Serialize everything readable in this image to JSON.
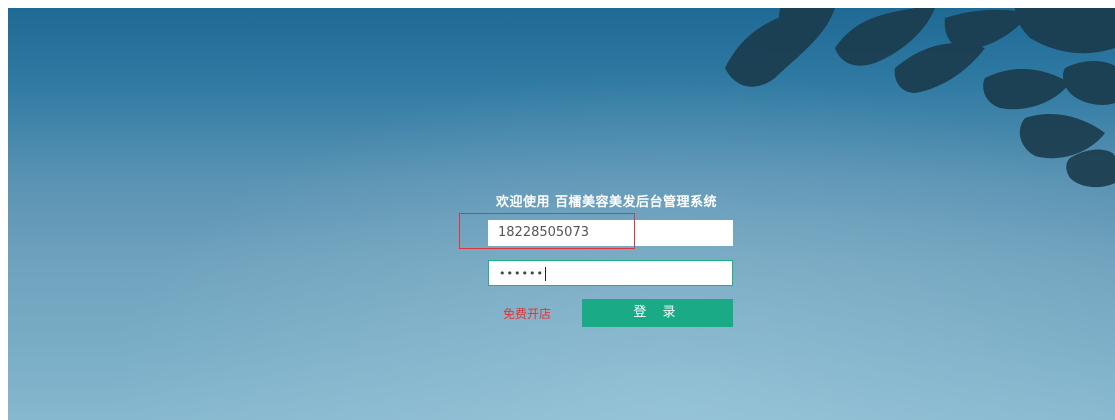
{
  "login": {
    "title": "欢迎使用 百檑美容美发后台管理系统",
    "username_value": "18228505073",
    "password_mask": "••••••",
    "register_link": "免费开店",
    "login_button": "登 录"
  },
  "colors": {
    "accent": "#1aab86",
    "link": "#e8302f",
    "highlight": "#e0353a"
  }
}
